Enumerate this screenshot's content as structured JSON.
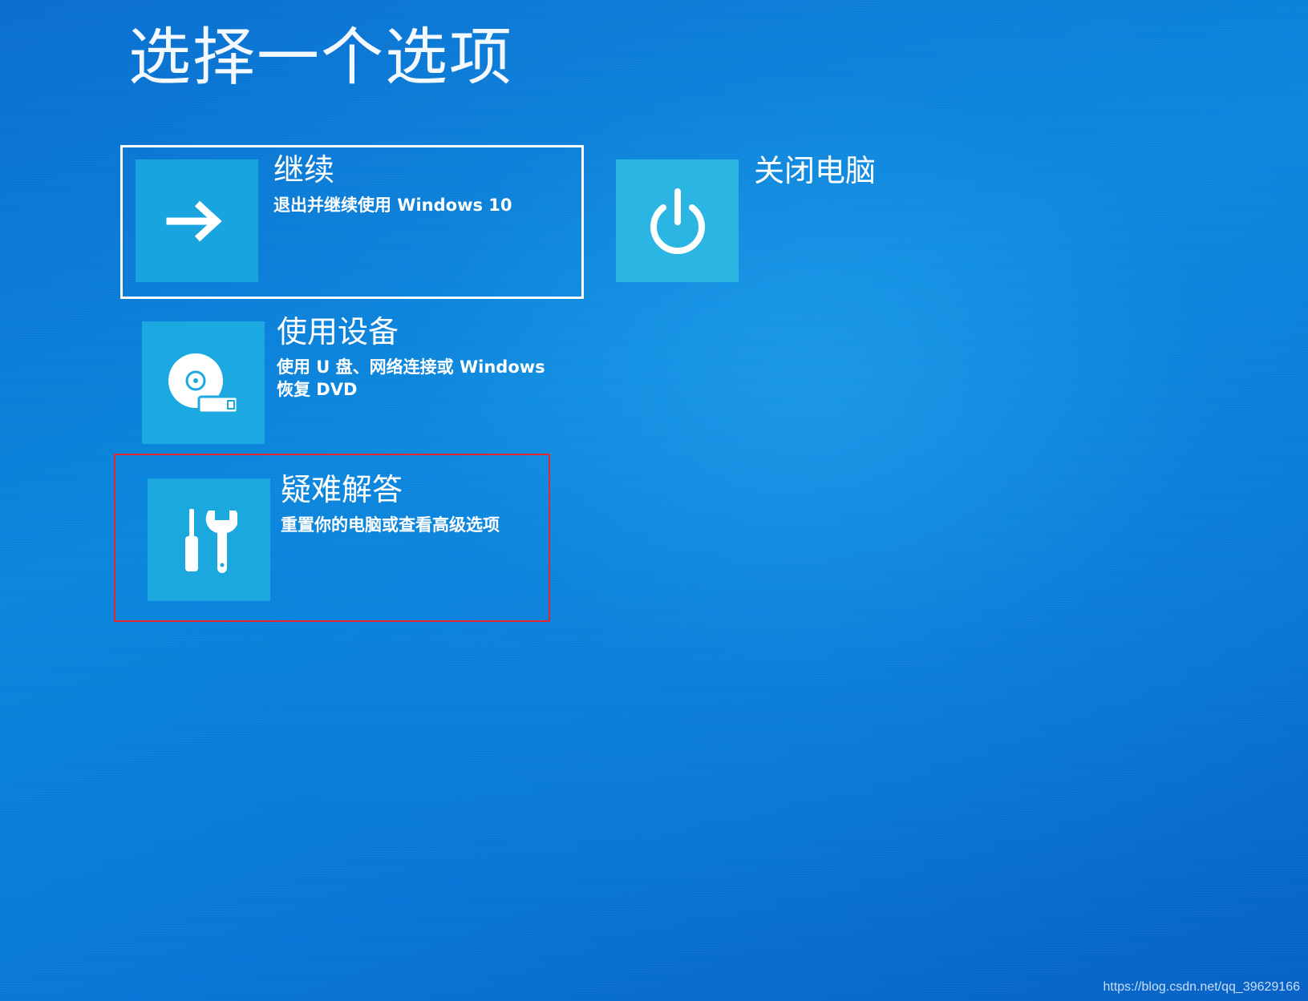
{
  "page": {
    "title": "选择一个选项"
  },
  "options": {
    "continue": {
      "label": "继续",
      "description": "退出并继续使用 Windows 10",
      "icon": "arrow-right-icon",
      "selected": true
    },
    "shutdown": {
      "label": "关闭电脑",
      "icon": "power-icon"
    },
    "use_device": {
      "label": "使用设备",
      "description": "使用 U 盘、网络连接或 Windows 恢复 DVD",
      "icon": "disc-usb-icon"
    },
    "troubleshoot": {
      "label": "疑难解答",
      "description": "重置你的电脑或查看高级选项",
      "icon": "tools-icon",
      "annotation_color": "#e3262f"
    }
  },
  "watermark": "https://blog.csdn.net/qq_39629166",
  "colors": {
    "background": "#0a7fd8",
    "tile": "#1ba7e0",
    "annotation": "#e3262f"
  }
}
